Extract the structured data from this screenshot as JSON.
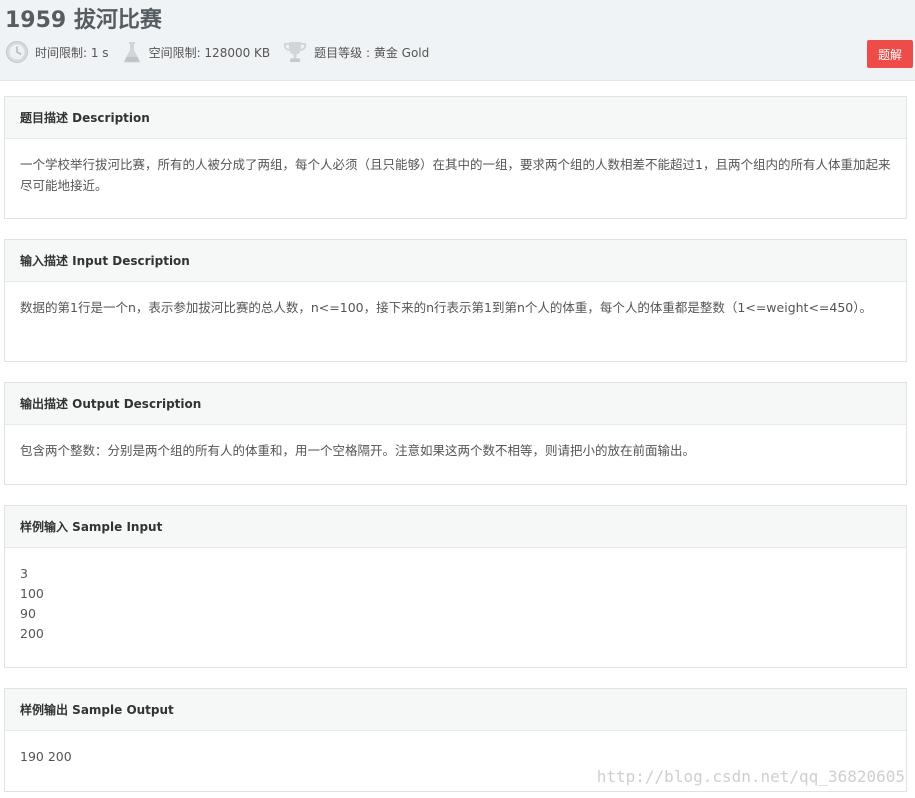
{
  "problem": {
    "title": "1959 拔河比赛",
    "time_limit": "时间限制: 1 s",
    "memory_limit": "空间限制: 128000 KB",
    "level": "题目等级 : 黄金 Gold",
    "solution_label": "题解"
  },
  "sections": {
    "description": {
      "heading": "题目描述 Description",
      "text": "一个学校举行拔河比赛，所有的人被分成了两组，每个人必须（且只能够）在其中的一组，要求两个组的人数相差不能超过1，且两个组内的所有人体重加起来尽可能地接近。"
    },
    "input": {
      "heading": "输入描述 Input Description",
      "text": "数据的第1行是一个n，表示参加拔河比赛的总人数，n<=100，接下来的n行表示第1到第n个人的体重，每个人的体重都是整数（1<=weight<=450）。"
    },
    "output": {
      "heading": "输出描述 Output Description",
      "text": "包含两个整数：分别是两个组的所有人的体重和，用一个空格隔开。注意如果这两个数不相等，则请把小的放在前面输出。"
    },
    "sample_input": {
      "heading": "样例输入 Sample Input",
      "lines": [
        "3",
        "100",
        "90",
        "200"
      ]
    },
    "sample_output": {
      "heading": "样例输出 Sample Output",
      "text": "190 200"
    }
  },
  "watermark": "http://blog.csdn.net/qq_36820605",
  "colors": {
    "header_bg": "#f0f3f5",
    "solution_button": "#ee4c48",
    "panel_head_bg": "#f6f8f8"
  },
  "icons": [
    "clock-icon",
    "flask-icon",
    "trophy-icon"
  ]
}
